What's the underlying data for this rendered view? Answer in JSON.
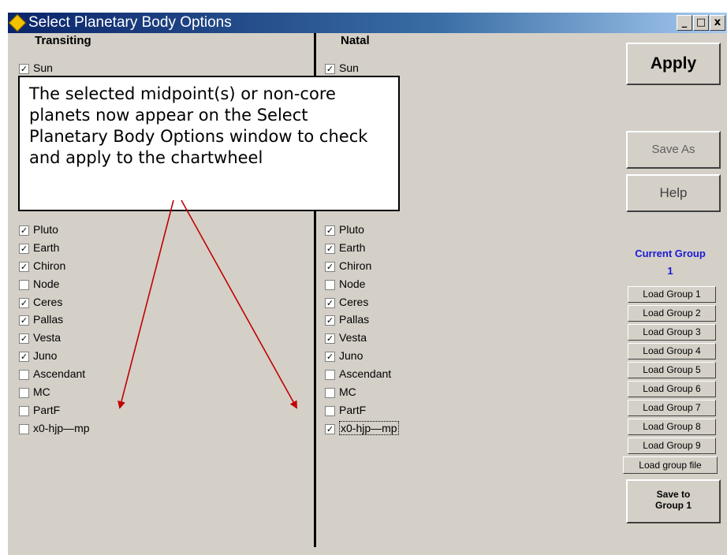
{
  "window": {
    "title": "Select Planetary Body Options"
  },
  "title_buttons": {
    "minimize": "_",
    "maximize": "□",
    "close": "x"
  },
  "transiting": {
    "heading": "Transiting",
    "items": [
      {
        "label": "Sun",
        "checked": true
      },
      {
        "label": "Pluto",
        "checked": true
      },
      {
        "label": "Earth",
        "checked": true
      },
      {
        "label": "Chiron",
        "checked": true
      },
      {
        "label": "Node",
        "checked": false
      },
      {
        "label": "Ceres",
        "checked": true
      },
      {
        "label": "Pallas",
        "checked": true
      },
      {
        "label": "Vesta",
        "checked": true
      },
      {
        "label": "Juno",
        "checked": true
      },
      {
        "label": "Ascendant",
        "checked": false
      },
      {
        "label": "MC",
        "checked": false
      },
      {
        "label": "PartF",
        "checked": false
      },
      {
        "label": "x0-hjp—mp",
        "checked": false
      }
    ]
  },
  "natal": {
    "heading": "Natal",
    "items": [
      {
        "label": "Sun",
        "checked": true
      },
      {
        "label": "Pluto",
        "checked": true
      },
      {
        "label": "Earth",
        "checked": true
      },
      {
        "label": "Chiron",
        "checked": true
      },
      {
        "label": "Node",
        "checked": false
      },
      {
        "label": "Ceres",
        "checked": true
      },
      {
        "label": "Pallas",
        "checked": true
      },
      {
        "label": "Vesta",
        "checked": true
      },
      {
        "label": "Juno",
        "checked": true
      },
      {
        "label": "Ascendant",
        "checked": false
      },
      {
        "label": "MC",
        "checked": false
      },
      {
        "label": "PartF",
        "checked": false
      },
      {
        "label": "x0-hjp—mp",
        "checked": true
      }
    ]
  },
  "buttons": {
    "apply": "Apply",
    "save_as": "Save As",
    "help": "Help",
    "load_group_file": "Load group file",
    "save_to_group_line1": "Save to",
    "save_to_group_line2": "Group 1"
  },
  "current_group": {
    "label": "Current Group",
    "value": "1"
  },
  "load_groups": [
    "Load Group 1",
    "Load Group 2",
    "Load Group 3",
    "Load Group 4",
    "Load Group 5",
    "Load Group 6",
    "Load Group 7",
    "Load Group 8",
    "Load Group 9"
  ],
  "callout": {
    "text": "The selected midpoint(s) or non-core planets now appear on the Select Planetary Body Options window to check and apply to the chartwheel"
  },
  "colors": {
    "arrow": "#c00000",
    "current_group": "#1a1ad4",
    "titlebar": "#0a246a"
  }
}
